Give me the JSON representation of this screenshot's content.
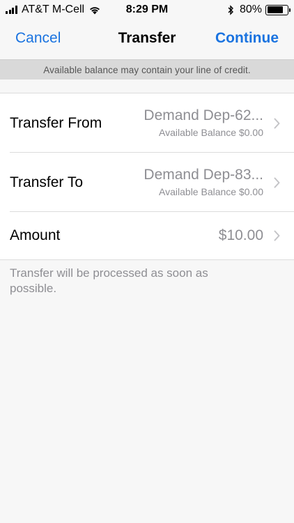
{
  "status_bar": {
    "carrier": "AT&T M-Cell",
    "time": "8:29 PM",
    "battery_percent": "80%",
    "battery_level": 0.8,
    "icons": [
      "signal-icon",
      "wifi-icon",
      "bluetooth-icon",
      "battery-icon"
    ]
  },
  "nav": {
    "cancel_label": "Cancel",
    "title": "Transfer",
    "continue_label": "Continue"
  },
  "notice": "Available balance may contain your line of credit.",
  "rows": [
    {
      "label": "Transfer From",
      "value": "Demand Dep-62...",
      "sub": "Available Balance $0.00"
    },
    {
      "label": "Transfer To",
      "value": "Demand Dep-83...",
      "sub": "Available Balance $0.00"
    },
    {
      "label": "Amount",
      "value": "$10.00"
    }
  ],
  "footnote": "Transfer will be processed as soon as possible.",
  "colors": {
    "accent": "#1a73e0",
    "secondary_text": "#8e8e93",
    "background": "#f7f7f7",
    "notice_bg": "#d9d9d9"
  }
}
